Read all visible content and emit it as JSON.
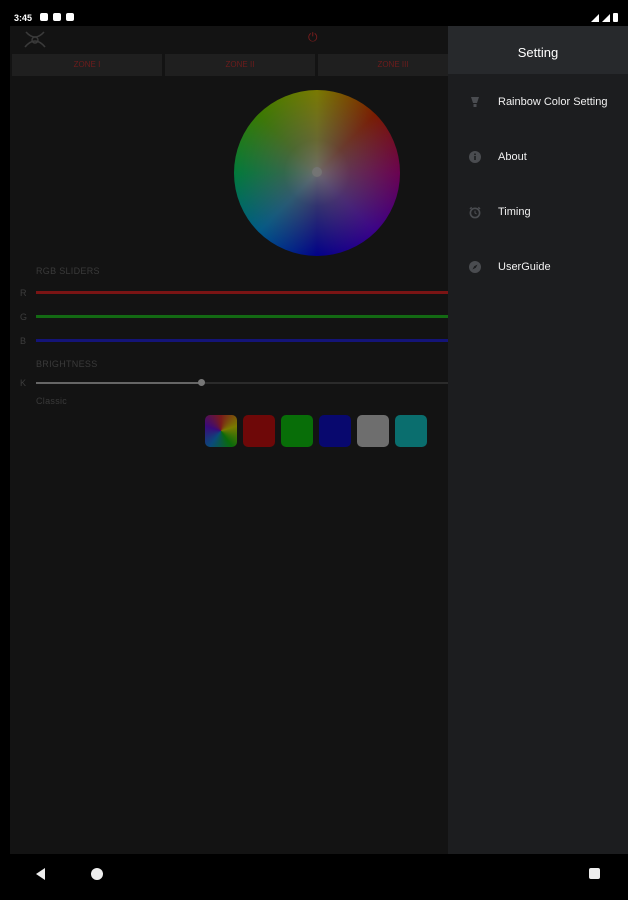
{
  "status_bar": {
    "time": "3:45",
    "icons": [
      "notification-icon",
      "app-icon",
      "storage-icon",
      "wifi-icon",
      "signal-icon",
      "battery-icon"
    ]
  },
  "main": {
    "zone_tabs": [
      "ZONE I",
      "ZONE II",
      "ZONE III"
    ],
    "power_icon": "power-icon",
    "rgb_title": "RGB SLIDERS",
    "sliders": [
      {
        "letter": "R",
        "color": "#7a1414"
      },
      {
        "letter": "G",
        "color": "#136a13"
      },
      {
        "letter": "B",
        "color": "#141478"
      }
    ],
    "brightness_title": "BRIGHTNESS",
    "brightness_letter": "K",
    "brightness_value": 0.39,
    "classic_label": "Classic",
    "swatches": [
      "rainbow",
      "#7a0808",
      "#087a08",
      "#08087a",
      "#7a7a7a",
      "#0a7a7a"
    ]
  },
  "drawer": {
    "title": "Setting",
    "items": [
      {
        "label": "Rainbow Color Setting",
        "icon": "lightbulb-icon"
      },
      {
        "label": "About",
        "icon": "info-icon"
      },
      {
        "label": "Timing",
        "icon": "alarm-clock-icon"
      },
      {
        "label": "UserGuide",
        "icon": "compass-icon"
      }
    ]
  },
  "nav": {
    "icons": [
      "back-icon",
      "home-icon",
      "recents-icon"
    ]
  }
}
